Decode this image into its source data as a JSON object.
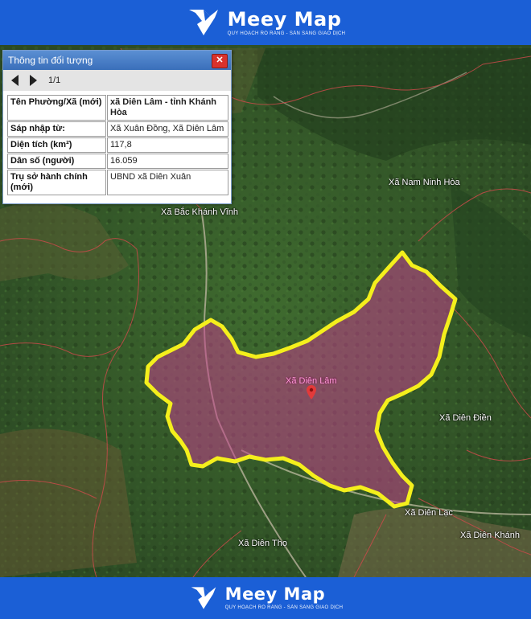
{
  "brand": {
    "name": "Meey Map",
    "tagline": "QUY HOẠCH RÕ RÀNG - SẴN SÀNG GIAO DỊCH"
  },
  "panel": {
    "title": "Thông tin đối tượng",
    "close_label": "✕",
    "pager": "1/1",
    "rows": [
      {
        "key": "Tên Phường/Xã (mới)",
        "value": "xã Diên Lâm - tỉnh Khánh Hòa"
      },
      {
        "key": "Sáp nhập từ:",
        "value": "Xã Xuân Đồng, Xã Diên Lâm"
      },
      {
        "key": "Diện tích (km²)",
        "value": "117,8"
      },
      {
        "key": "Dân số (người)",
        "value": "16.059"
      },
      {
        "key": "Trụ sở hành chính (mới)",
        "value": "UBND xã Diên Xuân"
      }
    ]
  },
  "map": {
    "highlight_color": "#f4ef1c",
    "fill_color": "#c2408c",
    "labels": {
      "nam_ninh_hoa": "Xã Nam Ninh Hòa",
      "bac_khanh_vinh": "Xã Bắc Khánh Vĩnh",
      "dien_lam": "Xã Diên Lâm",
      "dien_dien": "Xã Diên Điền",
      "dien_lac": "Xã Diên Lạc",
      "dien_khanh": "Xã Diên Khánh",
      "dien_tho": "Xã Diên Thọ"
    }
  }
}
